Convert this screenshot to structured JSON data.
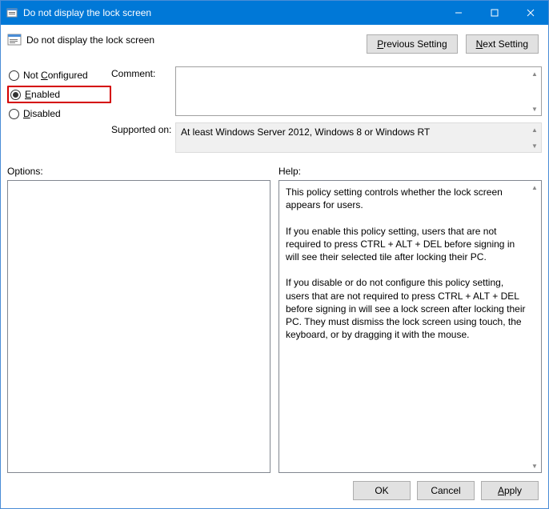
{
  "titlebar": {
    "title": "Do not display the lock screen"
  },
  "header": {
    "policy_title": "Do not display the lock screen",
    "prev_prefix": "P",
    "prev_suffix": "revious Setting",
    "next_prefix": "N",
    "next_suffix": "ext Setting"
  },
  "radios": {
    "not_configured_u": "C",
    "not_configured_rest": "onfigured",
    "not_configured_pre": "Not ",
    "enabled_u": "E",
    "enabled_rest": "nabled",
    "disabled_u": "D",
    "disabled_rest": "isabled"
  },
  "labels": {
    "comment": "Comment:",
    "supported": "Supported on:",
    "options": "Options:",
    "help": "Help:"
  },
  "supported_text": "At least Windows Server 2012, Windows 8 or Windows RT",
  "help_text": "This policy setting controls whether the lock screen appears for users.\n\nIf you enable this policy setting, users that are not required to press CTRL + ALT + DEL before signing in will see their selected tile after locking their PC.\n\nIf you disable or do not configure this policy setting, users that are not required to press CTRL + ALT + DEL before signing in will see a lock screen after locking their PC. They must dismiss the lock screen using touch, the keyboard, or by dragging it with the mouse.",
  "footer": {
    "ok": "OK",
    "cancel": "Cancel",
    "apply_u": "A",
    "apply_rest": "pply"
  }
}
